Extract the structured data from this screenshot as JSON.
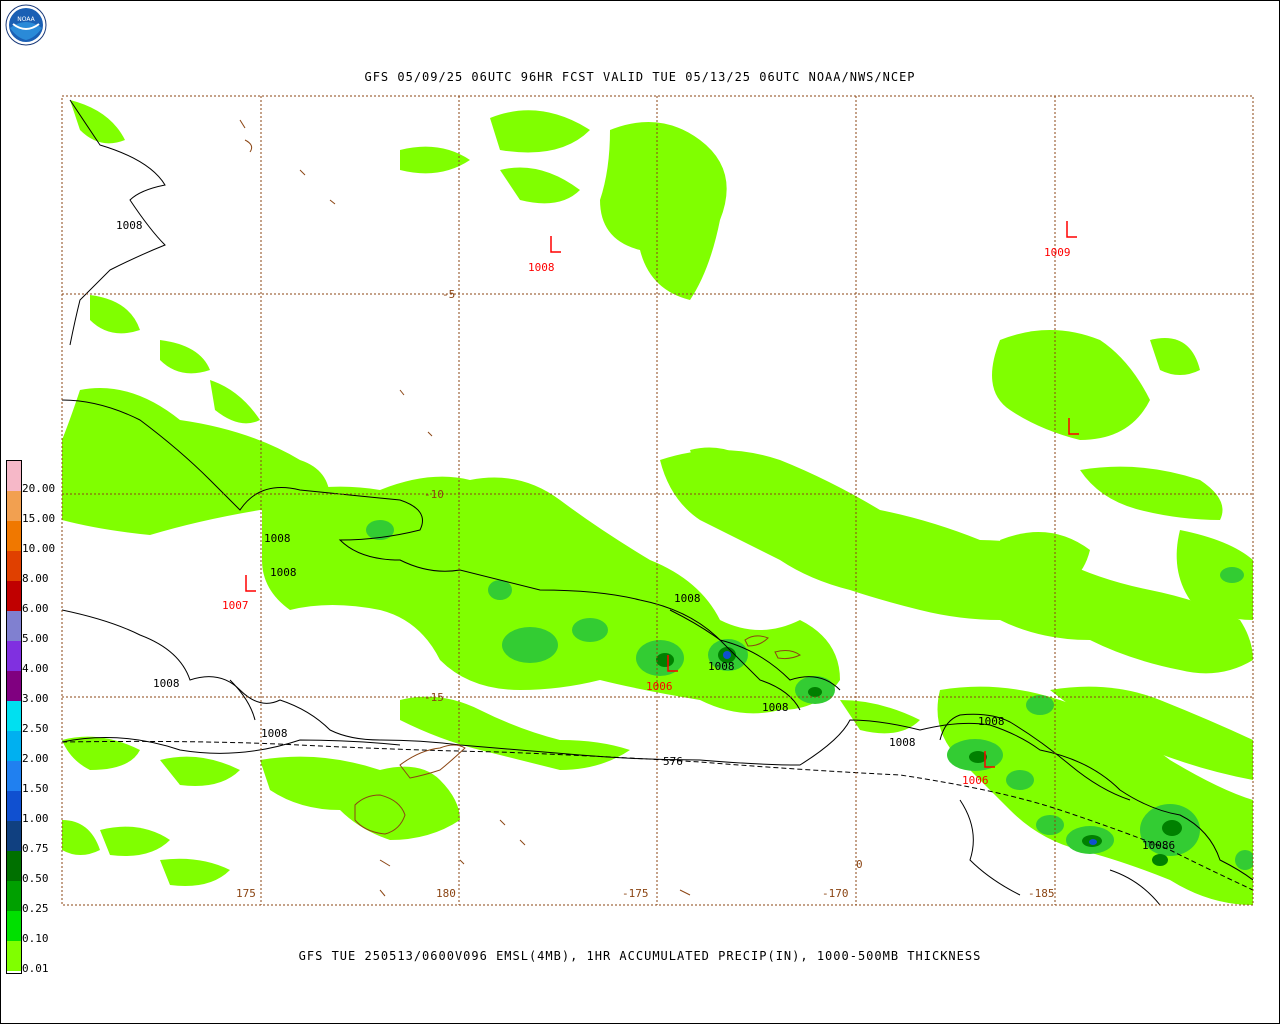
{
  "header": {
    "top_title": "GFS 05/09/25 06UTC 96HR FCST VALID TUE 05/13/25 06UTC NOAA/NWS/NCEP",
    "bottom_title": "GFS TUE 250513/0600V096 EMSL(4MB), 1HR ACCUMULATED PRECIP(IN), 1000-500MB THICKNESS",
    "logo_text": "NOAA"
  },
  "legend": {
    "title": "",
    "entries": [
      {
        "label": "20.00",
        "color": "#f6b8c8"
      },
      {
        "label": "15.00",
        "color": "#f2a050"
      },
      {
        "label": "10.00",
        "color": "#f07800"
      },
      {
        "label": "8.00",
        "color": "#e04000"
      },
      {
        "label": "6.00",
        "color": "#c00000"
      },
      {
        "label": "5.00",
        "color": "#8080d0"
      },
      {
        "label": "4.00",
        "color": "#8030e0"
      },
      {
        "label": "3.00",
        "color": "#800080"
      },
      {
        "label": "2.50",
        "color": "#00e0f0"
      },
      {
        "label": "2.00",
        "color": "#00b0f0"
      },
      {
        "label": "1.50",
        "color": "#2080f0"
      },
      {
        "label": "1.00",
        "color": "#1050d0"
      },
      {
        "label": "0.75",
        "color": "#104080"
      },
      {
        "label": "0.50",
        "color": "#007000"
      },
      {
        "label": "0.25",
        "color": "#00a000"
      },
      {
        "label": "0.10",
        "color": "#00e000"
      },
      {
        "label": "0.01",
        "color": "#80ff00"
      }
    ]
  },
  "map": {
    "lat_labels": [
      "-5",
      "-10",
      "-15"
    ],
    "lon_labels": [
      "175",
      "180",
      "-175",
      "-170",
      "-185"
    ],
    "lon_extra_label": "0",
    "thickness_label": "576",
    "low_symbol": "L",
    "lows": [
      {
        "pressure": "1008"
      },
      {
        "pressure": "1009"
      },
      {
        "pressure": "1007"
      },
      {
        "pressure": "1006"
      },
      {
        "pressure": "1006"
      }
    ],
    "isobar_labels": [
      "1008",
      "1008",
      "1008",
      "1008",
      "1008",
      "1008",
      "1008",
      "1008",
      "1008",
      "1008",
      "1008",
      "1008",
      "10086"
    ]
  },
  "colors": {
    "precip_light": "#80ff00",
    "precip_mid": "#33cc33",
    "precip_dark": "#008000",
    "grid": "#8b4513",
    "coast": "#8b4513",
    "low": "#ff0000"
  }
}
